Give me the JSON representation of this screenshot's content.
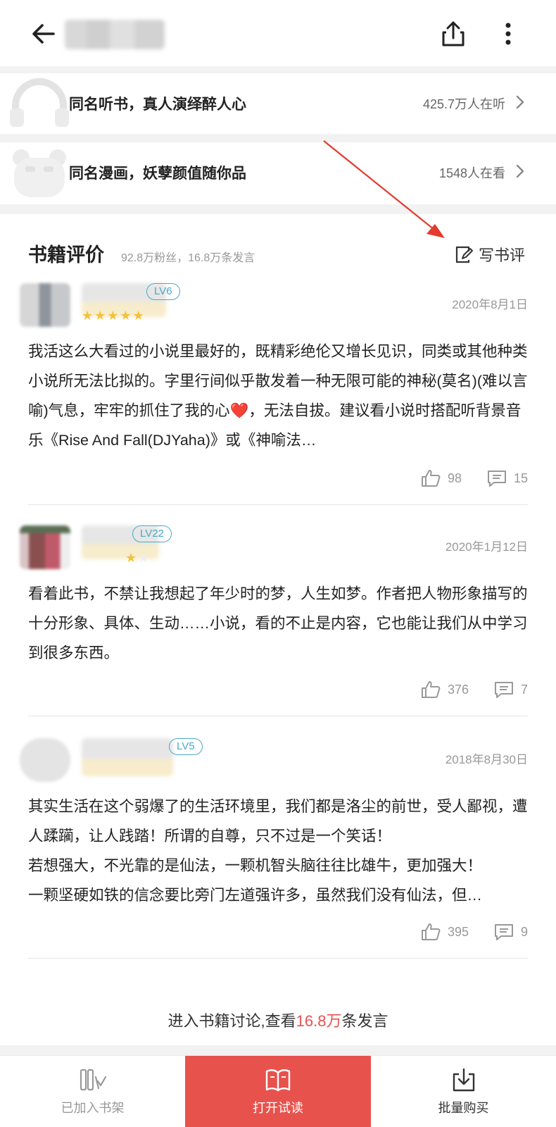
{
  "header": {
    "back_icon": "arrow-left-icon",
    "share_icon": "share-icon",
    "more_icon": "more-vertical-icon"
  },
  "promos": [
    {
      "label": "同名听书，真人演绎醉人心",
      "count": "425.7万人在听",
      "icon": "headphones-icon"
    },
    {
      "label": "同名漫画，妖孽颜值随你品",
      "count": "1548人在看",
      "icon": "comic-icon"
    }
  ],
  "reviews_section": {
    "title": "书籍评价",
    "subtitle": "92.8万粉丝，16.8万条发言",
    "write_label": "写书评",
    "write_icon": "edit-note-icon"
  },
  "reviews": [
    {
      "level": "LV6",
      "date": "2020年8月1日",
      "stars": 5,
      "content": "我活这么大看过的小说里最好的，既精彩绝伦又增长见识，同类或其他种类小说所无法比拟的。字里行间似乎散发着一种无限可能的神秘(莫名)(难以言喻)气息，牢牢的抓住了我的心❤️，无法自拔。建议看小说时搭配听背景音乐《Rise And Fall(DJYaha)》或《神喻法…",
      "likes": "98",
      "comments": "15"
    },
    {
      "level": "LV22",
      "date": "2020年1月12日",
      "stars": 4,
      "content": "看着此书，不禁让我想起了年少时的梦，人生如梦。作者把人物形象描写的十分形象、具体、生动……小说，看的不止是内容，它也能让我们从中学习到很多东西。",
      "likes": "376",
      "comments": "7"
    },
    {
      "level": "LV5",
      "date": "2018年8月30日",
      "stars": 0,
      "content": "其实生活在这个弱爆了的生活环境里，我们都是洛尘的前世，受人鄙视，遭人蹂躏，让人践踏！所谓的自尊，只不过是一个笑话！\n若想强大，不光靠的是仙法，一颗机智头脑往往比雄牛，更加强大！\n一颗坚硬如铁的信念要比旁门左道强许多，虽然我们没有仙法，但…",
      "likes": "395",
      "comments": "9"
    }
  ],
  "discussion_link": {
    "prefix": "进入书籍讨论,查看",
    "highlight": "16.8万",
    "suffix": "条发言"
  },
  "bottom_bar": {
    "shelf_label": "已加入书架",
    "read_label": "打开试读",
    "buy_label": "批量购买"
  },
  "colors": {
    "accent": "#e8524d",
    "level_badge": "#49a9c7",
    "star": "#f5c13b"
  }
}
